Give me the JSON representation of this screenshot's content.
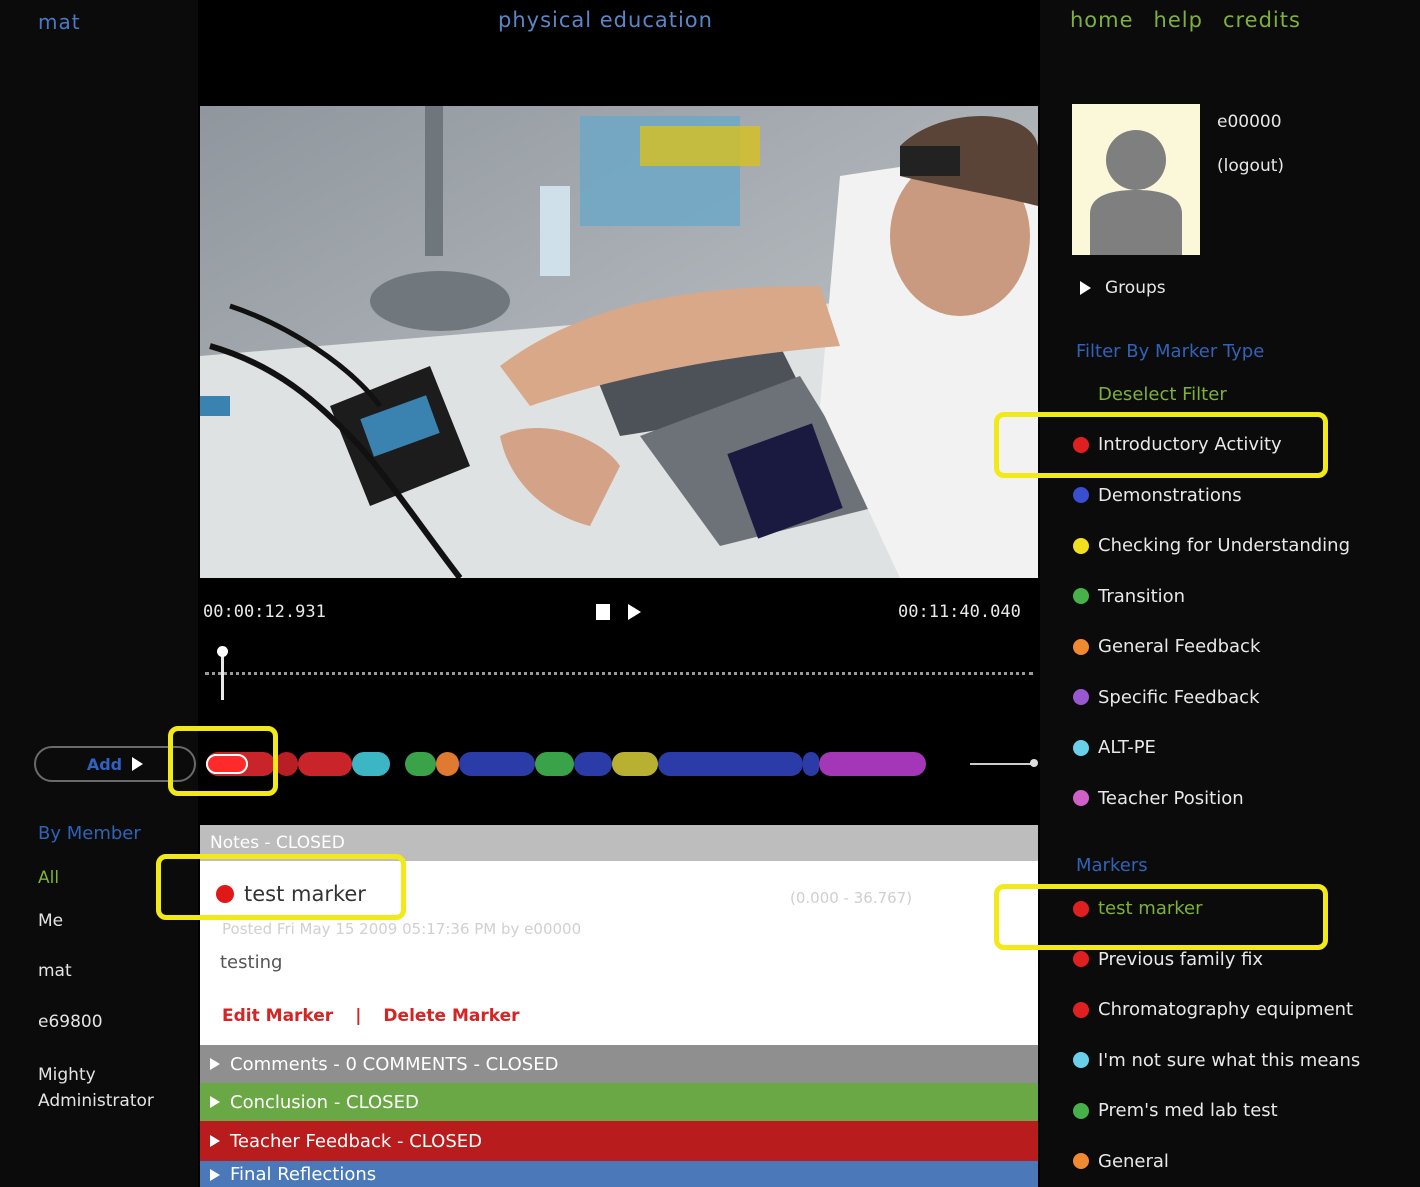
{
  "header": {
    "user": "mat",
    "title": "physical education",
    "nav": [
      "home",
      "help",
      "credits"
    ]
  },
  "player": {
    "current_time": "00:00:12.931",
    "duration": "00:11:40.040",
    "progress_fraction": 0.018,
    "add_label": "Add"
  },
  "timeline_segments": [
    {
      "start": 0.0,
      "end": 0.09,
      "color": "#c8242a"
    },
    {
      "start": 0.09,
      "end": 0.12,
      "color": "#b81f25"
    },
    {
      "start": 0.12,
      "end": 0.19,
      "color": "#c8242a"
    },
    {
      "start": 0.19,
      "end": 0.24,
      "color": "#3cb5c4"
    },
    {
      "start": 0.26,
      "end": 0.3,
      "color": "#3aa34a"
    },
    {
      "start": 0.3,
      "end": 0.33,
      "color": "#e07a30"
    },
    {
      "start": 0.33,
      "end": 0.43,
      "color": "#2b3ca8"
    },
    {
      "start": 0.43,
      "end": 0.48,
      "color": "#3aa34a"
    },
    {
      "start": 0.48,
      "end": 0.53,
      "color": "#2b3ca8"
    },
    {
      "start": 0.53,
      "end": 0.59,
      "color": "#b8b030"
    },
    {
      "start": 0.59,
      "end": 0.78,
      "color": "#2b3ca8"
    },
    {
      "start": 0.78,
      "end": 0.8,
      "color": "#2b3ca8"
    },
    {
      "start": 0.8,
      "end": 0.94,
      "color": "#a436b8"
    }
  ],
  "members": {
    "heading": "By Member",
    "items": [
      "All",
      "Me",
      "mat",
      "e69800",
      "Mighty\nAdministrator"
    ]
  },
  "notes": {
    "header": "Notes - CLOSED",
    "marker_title": "test marker",
    "range": "(0.000 - 36.767)",
    "posted": "Posted Fri May 15 2009 05:17:36 PM by e00000",
    "text": "testing",
    "edit_label": "Edit Marker",
    "separator": "|",
    "delete_label": "Delete Marker"
  },
  "sections": [
    {
      "label": "Comments - 0 COMMENTS - CLOSED",
      "color": "#8f8f8f"
    },
    {
      "label": "Conclusion - CLOSED",
      "color": "#6aa845"
    },
    {
      "label": "Teacher Feedback - CLOSED",
      "color": "#b81c1c"
    },
    {
      "label": "Final Reflections",
      "color": "#4a78b8"
    }
  ],
  "profile": {
    "user_id": "e00000",
    "logout": "(logout)",
    "groups": "Groups"
  },
  "filter": {
    "heading": "Filter By Marker Type",
    "deselect": "Deselect Filter",
    "items": [
      {
        "label": "Introductory Activity",
        "color": "#e02020"
      },
      {
        "label": "Demonstrations",
        "color": "#3a4ed0"
      },
      {
        "label": "Checking for Understanding",
        "color": "#f0e020"
      },
      {
        "label": "Transition",
        "color": "#48b048"
      },
      {
        "label": "General Feedback",
        "color": "#f08a30"
      },
      {
        "label": "Specific Feedback",
        "color": "#9a58d0"
      },
      {
        "label": "ALT-PE",
        "color": "#6ad0ea"
      },
      {
        "label": "Teacher Position",
        "color": "#d060c8"
      }
    ]
  },
  "markers": {
    "heading": "Markers",
    "items": [
      {
        "label": "test marker",
        "color": "#e02020"
      },
      {
        "label": "Previous family fix",
        "color": "#e02020"
      },
      {
        "label": "Chromatography equipment",
        "color": "#e02020"
      },
      {
        "label": "I'm not sure what this means",
        "color": "#6ad0ea"
      },
      {
        "label": "Prem's med lab test",
        "color": "#48b048"
      },
      {
        "label": "General",
        "color": "#f08a30"
      }
    ]
  }
}
